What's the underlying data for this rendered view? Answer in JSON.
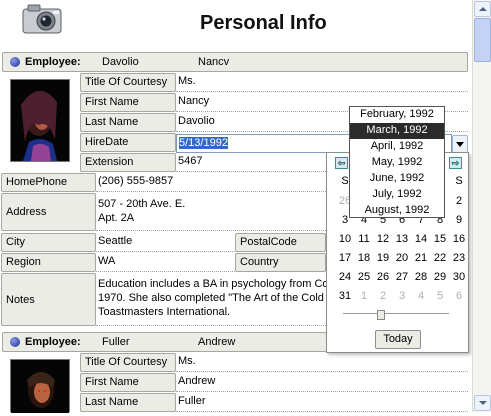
{
  "page": {
    "title": "Personal Info"
  },
  "employees": [
    {
      "label": "Employee:",
      "first_name": "Davolio",
      "last_name": "Nancv",
      "fields": {
        "title_of_courtesy": {
          "label": "Title Of Courtesy",
          "value": "Ms."
        },
        "first_name": {
          "label": "First Name",
          "value": "Nancy"
        },
        "last_name": {
          "label": "Last Name",
          "value": "Davolio"
        },
        "hire_date": {
          "label": "HireDate",
          "value": "5/13/1992"
        },
        "extension": {
          "label": "Extension",
          "value": "5467"
        },
        "home_phone": {
          "label": "HomePhone",
          "value": "(206) 555-9857"
        },
        "address": {
          "label": "Address",
          "line1": "507 - 20th Ave. E.",
          "line2": "Apt. 2A"
        },
        "city": {
          "label": "City",
          "value": "Seattle"
        },
        "postal_code": {
          "label": "PostalCode",
          "value": ""
        },
        "region": {
          "label": "Region",
          "value": "WA"
        },
        "country": {
          "label": "Country",
          "value": ""
        },
        "notes": {
          "label": "Notes",
          "line1": "Education includes a BA in psychology from Co",
          "line2": "1970.  She also completed \"The Art of the Cold",
          "line3": "Toastmasters International."
        }
      }
    },
    {
      "label": "Employee:",
      "first_name": "Fuller",
      "last_name": "Andrew",
      "fields": {
        "title_of_courtesy": {
          "label": "Title Of Courtesy",
          "value": "Ms."
        },
        "first_name": {
          "label": "First Name",
          "value": "Andrew"
        },
        "last_name": {
          "label": "Last Name",
          "value": "Fuller"
        }
      }
    }
  ],
  "calendar": {
    "month_list": [
      "February, 1992",
      "March, 1992",
      "April, 1992",
      "May, 1992",
      "June, 1992",
      "July, 1992",
      "August, 1992"
    ],
    "selected_month": "March, 1992",
    "day_header_left": "S",
    "day_header_right": "S",
    "rows": [
      [
        "26",
        "",
        "",
        "",
        "",
        "",
        "2"
      ],
      [
        "3",
        "4",
        "5",
        "6",
        "7",
        "8",
        "9"
      ],
      [
        "10",
        "11",
        "12",
        "13",
        "14",
        "15",
        "16"
      ],
      [
        "17",
        "18",
        "19",
        "20",
        "21",
        "22",
        "23"
      ],
      [
        "24",
        "25",
        "26",
        "27",
        "28",
        "29",
        "30"
      ],
      [
        "31",
        "1",
        "2",
        "3",
        "4",
        "5",
        "6"
      ]
    ],
    "today_label": "Today",
    "prev_symbol": "⇦",
    "next_symbol": "⇨"
  },
  "colors": {
    "selection": "#316ac5",
    "header_bg": "#ecece7",
    "month_selected": "#2b2b2b"
  }
}
